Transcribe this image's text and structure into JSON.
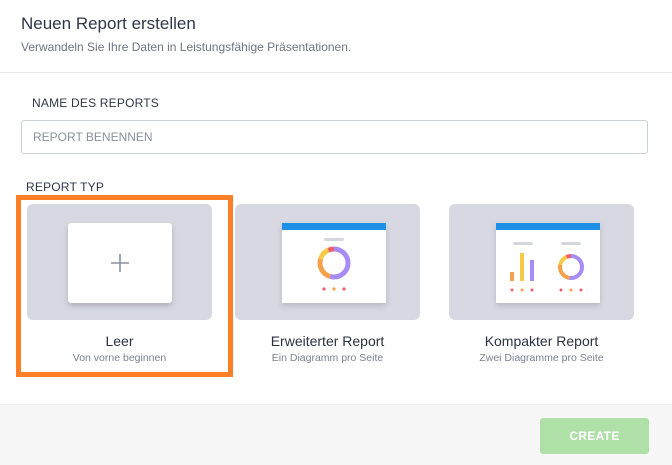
{
  "dialog": {
    "title": "Neuen Report erstellen",
    "subtitle": "Verwandeln Sie Ihre Daten in Leistungsfähige Präsentationen."
  },
  "name_section": {
    "label": "NAME DES REPORTS",
    "input_value": "",
    "placeholder": "REPORT BENENNEN"
  },
  "type_section": {
    "label": "REPORT TYP",
    "selected": "Leer",
    "cards": [
      {
        "title": "Leer",
        "subtitle": "Von vorne beginnen",
        "icon": "plus-icon",
        "selected": true
      },
      {
        "title": "Erweiterter Report",
        "subtitle": "Ein Diagramm pro Seite",
        "icon": "donut-chart-icon",
        "selected": false
      },
      {
        "title": "Kompakter Report",
        "subtitle": "Zwei Diagramme pro Seite",
        "icon": "bar-and-donut-chart-icon",
        "selected": false
      }
    ]
  },
  "footer": {
    "create_label": "CREATE",
    "create_enabled": false
  },
  "colors": {
    "selection_border": "#ff7f27",
    "card_background": "#d7d8e2",
    "preview_header": "#1e90e8",
    "create_button": "#aee0a8",
    "donut_segments": [
      "#a78bf6",
      "#f5a14b",
      "#f7c948",
      "#f25f6b"
    ]
  }
}
